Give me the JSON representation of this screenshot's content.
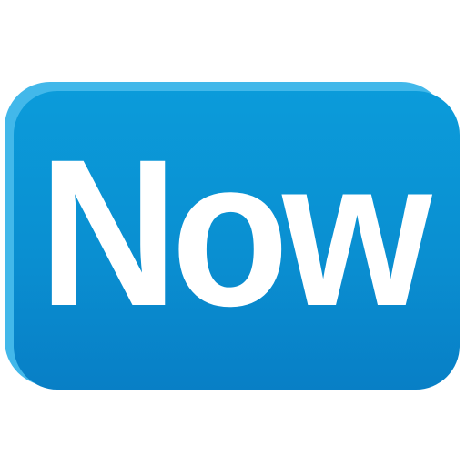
{
  "icon": {
    "label": "Now",
    "colors": {
      "light_edge": "#42b8ea",
      "main_top": "#0b9bda",
      "main_bottom": "#087fc6",
      "text": "#ffffff"
    }
  }
}
